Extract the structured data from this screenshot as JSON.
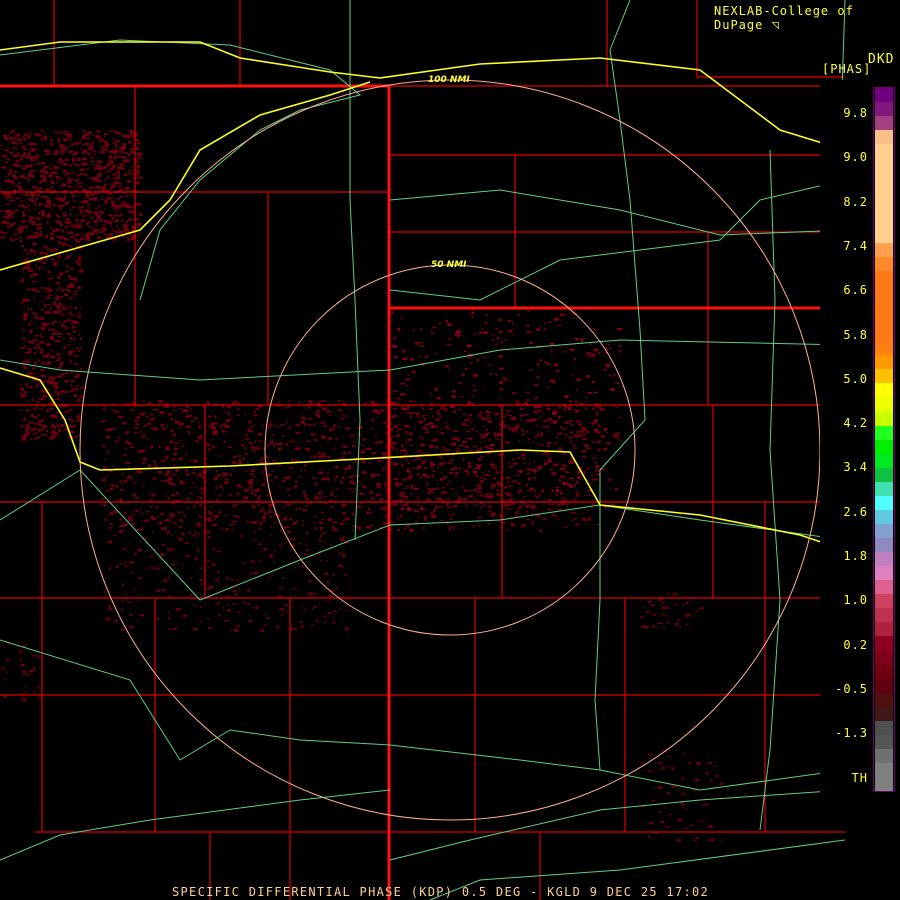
{
  "header": {
    "credit": "NEXLAB-College of DuPage",
    "logo_glyph": "◹",
    "product_code": "DKD",
    "unit": "[PHAS]"
  },
  "rings": [
    {
      "label": "100 NMI"
    },
    {
      "label": "50 NMI"
    }
  ],
  "legend": {
    "ticks": [
      "9.8",
      "9.0",
      "8.2",
      "7.4",
      "6.6",
      "5.8",
      "5.0",
      "4.2",
      "3.4",
      "2.6",
      "1.8",
      "1.0",
      "0.2",
      "-0.5",
      "-1.3",
      "TH"
    ],
    "colors": [
      "#700080",
      "#801880",
      "#a04080",
      "#f8c088",
      "#ffd090",
      "#ffd090",
      "#ffd090",
      "#ffd090",
      "#ffd090",
      "#ffd090",
      "#ffd090",
      "#ffa050",
      "#ff8828",
      "#ff7818",
      "#ff7818",
      "#ff7818",
      "#ff7818",
      "#ff7818",
      "#ff8010",
      "#ff9800",
      "#ffc000",
      "#ffff00",
      "#f0ff00",
      "#c8ff00",
      "#20ff20",
      "#00f000",
      "#00e820",
      "#10c040",
      "#40e0b0",
      "#50ffff",
      "#60c8e0",
      "#80a0d0",
      "#9088c0",
      "#c080c0",
      "#e080c0",
      "#e06090",
      "#d04060",
      "#c03050",
      "#b02040",
      "#900020",
      "#800018",
      "#700010",
      "#600010",
      "#501010",
      "#401818",
      "#505050",
      "#555555",
      "#707070",
      "#808080",
      "#808080"
    ]
  },
  "footer": {
    "text": "SPECIFIC DIFFERENTIAL PHASE (KDP) 0.5 DEG - KGLD 9 DEC 25 17:02"
  }
}
